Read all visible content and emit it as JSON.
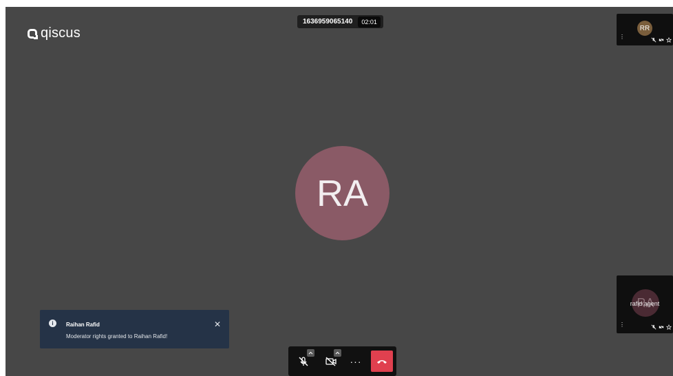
{
  "brand": {
    "name": "qiscus"
  },
  "session": {
    "room_id": "1636959065140",
    "timer": "02:01"
  },
  "main_participant": {
    "initials": "RA",
    "avatar_color": "#8a5a66"
  },
  "thumbnails": [
    {
      "initials": "RR",
      "name": "",
      "avatar_color": "#7a5e3c"
    },
    {
      "initials": "RA",
      "name": "rafid agent",
      "avatar_color": "#4a2a33"
    }
  ],
  "notification": {
    "title": "Raihan Rafid",
    "message": "Moderator rights granted to Raihan Rafid!",
    "close_label": "✕"
  },
  "toolbar": {
    "more_label": "···",
    "hangup_color": "#e0404f"
  },
  "colors": {
    "stage": "#474747",
    "toast_bg": "#253347",
    "toolbar_bg": "#111111"
  }
}
